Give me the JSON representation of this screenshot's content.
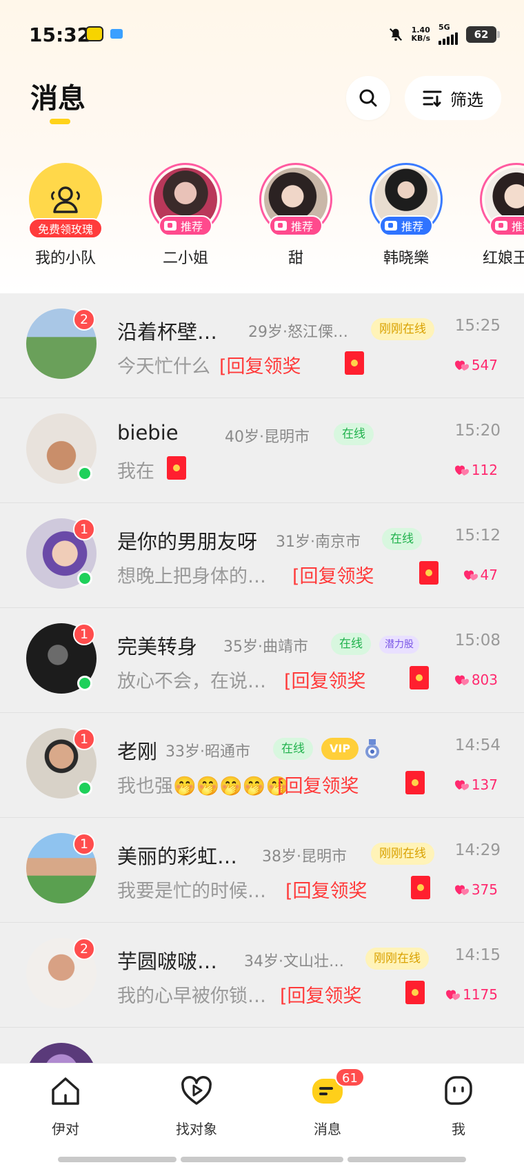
{
  "status_bar": {
    "time": "15:32",
    "net_speed_top": "1.40",
    "net_speed_bottom": "KB/s",
    "network": "5G",
    "battery": "62"
  },
  "header": {
    "title": "消息",
    "filter_label": "筛选"
  },
  "stories": [
    {
      "name": "我的小队",
      "tag": "免费领玫瑰",
      "type": "team"
    },
    {
      "name": "二小姐",
      "tag": "推荐",
      "color": "pink"
    },
    {
      "name": "甜",
      "tag": "推荐",
      "color": "pink"
    },
    {
      "name": "韩晓樂",
      "tag": "推荐",
      "color": "blue"
    },
    {
      "name": "红娘王",
      "tag": "推荐",
      "color": "pink"
    }
  ],
  "conversations": [
    {
      "name": "沿着杯壁…",
      "meta": "29岁·怒江傈…",
      "status": "刚刚在线",
      "time": "15:25",
      "message": "今天忙什么",
      "reply": "[回复领奖",
      "hearts": "547",
      "unread": "2",
      "online": false
    },
    {
      "name": "biebie",
      "meta": "40岁·昆明市",
      "status": "在线",
      "time": "15:20",
      "message": "我在",
      "reply": "",
      "hearts": "112",
      "unread": "",
      "online": true
    },
    {
      "name": "是你的男朋友呀",
      "meta": "31岁·南京市",
      "status": "在线",
      "time": "15:12",
      "message": "想晚上把身体的…",
      "reply": "[回复领奖",
      "hearts": "47",
      "unread": "1",
      "online": true
    },
    {
      "name": "完美转身",
      "meta": "35岁·曲靖市",
      "status": "在线",
      "extra": "潜力股",
      "time": "15:08",
      "message": "放心不会，在说…",
      "reply": "[回复领奖",
      "hearts": "803",
      "unread": "1",
      "online": true
    },
    {
      "name": "老刚",
      "meta": "33岁·昭通市",
      "status": "在线",
      "vip": "VIP",
      "time": "14:54",
      "message": "我也强🤭🤭🤭🤭🤭",
      "reply": "[回复领奖",
      "hearts": "137",
      "unread": "1",
      "online": true
    },
    {
      "name": "美丽的彩虹…",
      "meta": "38岁·昆明市",
      "status": "刚刚在线",
      "time": "14:29",
      "message": "我要是忙的时候…",
      "reply": "[回复领奖",
      "hearts": "375",
      "unread": "1",
      "online": false
    },
    {
      "name": "芋圆啵啵…",
      "meta": "34岁·文山壮…",
      "status": "刚刚在线",
      "time": "14:15",
      "message": "我的心早被你锁…",
      "reply": "[回复领奖",
      "hearts": "1175",
      "unread": "2",
      "online": false
    }
  ],
  "tabbar": {
    "tabs": [
      "伊对",
      "找对象",
      "消息",
      "我"
    ],
    "message_badge": "61"
  },
  "colors": {
    "accent_yellow": "#ffd21a",
    "reply_red": "#ff3a3a",
    "online_green": "#1ed05a",
    "heart_pink": "#ff2a6f"
  }
}
